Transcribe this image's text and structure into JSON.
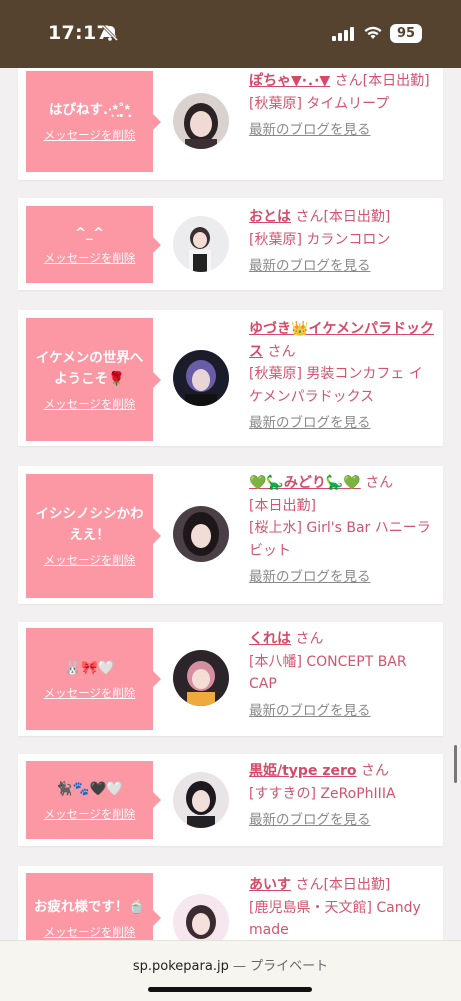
{
  "status_bar": {
    "time": "17:17",
    "battery": "95"
  },
  "colors": {
    "accent": "#fb98a4",
    "name_pink": "#d64a67",
    "status_bg": "#55422f"
  },
  "messages": [
    {
      "message": "はぴねす.·͙*̩̩͙˚̩̥̩̥*̩̩̥͙",
      "delete_label": "メッセージを削除",
      "name": "ぽちゃ▼·．·▼",
      "san": "さん",
      "badge": "[本日出勤]",
      "shop": "[秋葉原] タイムリープ",
      "blog": "最新のブログを見る"
    },
    {
      "message": "^_^",
      "delete_label": "メッセージを削除",
      "name": "おとは",
      "san": "さん",
      "badge": "[本日出勤]",
      "shop": "[秋葉原] カランコロン",
      "blog": "最新のブログを見る"
    },
    {
      "message": "イケメンの世界へようこそ🌹",
      "delete_label": "メッセージを削除",
      "name": "ゆづき👑イケメンパラドックス",
      "san": "さん",
      "badge": "",
      "shop": "[秋葉原] 男装コンカフェ イケメンパラドックス",
      "blog": "最新のブログを見る"
    },
    {
      "message": "イシシノシシかわええ！",
      "delete_label": "メッセージを削除",
      "name": "💚🦕みどり🦕💚",
      "san": "さん",
      "badge": "[本日出勤]",
      "shop": "[桜上水] Girl's Bar ハニーラビット",
      "blog": "最新のブログを見る"
    },
    {
      "message": "🐰🎀🤍",
      "delete_label": "メッセージを削除",
      "name": "くれは",
      "san": "さん",
      "badge": "",
      "shop": "[本八幡] CONCEPT BAR CAP",
      "blog": "最新のブログを見る"
    },
    {
      "message": "🐈‍⬛🐾🖤🤍",
      "delete_label": "メッセージを削除",
      "name": "黒姫/type zero",
      "san": "さん",
      "badge": "",
      "shop": "[すすきの] ZeRoPhIIIA",
      "blog": "最新のブログを見る"
    },
    {
      "message": "お疲れ様です！🍵",
      "delete_label": "メッセージを削除",
      "name": "あいす",
      "san": "さん",
      "badge": "[本日出勤]",
      "shop": "[鹿児島県・天文館] Candy made",
      "blog": ""
    }
  ],
  "browser": {
    "domain": "sp.pokepara.jp",
    "separator": " — ",
    "mode": "プライベート"
  }
}
